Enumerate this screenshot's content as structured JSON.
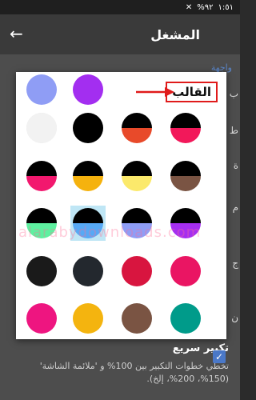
{
  "status_bar": {
    "time": "١:٥١",
    "battery": "%٩٢",
    "signal_off": "✕"
  },
  "app_bar": {
    "title": "المشغل",
    "back_icon": "arrow-left-icon"
  },
  "settings": {
    "section_label": "واجهة",
    "fragments": [
      "ب",
      "ط",
      "ة",
      "م",
      "ج",
      "ن"
    ]
  },
  "quick_zoom": {
    "title": "تكبير سريع",
    "description": "تخطي خطوات التكبير بين 100% و 'ملائمة الشاشة' (150%، 200%، إلخ).",
    "checked": true
  },
  "dialog": {
    "title": "القالب",
    "selected_index": 9,
    "themes": [
      {
        "top": "#f2f2f2",
        "bottom": "#f2f2f2"
      },
      {
        "top": "#000000",
        "bottom": "#000000"
      },
      {
        "top": "#000000",
        "bottom": "#e84a2a"
      },
      {
        "top": "#000000",
        "bottom": "#f2185a"
      },
      {
        "top": "#000000",
        "bottom": "#f2186e"
      },
      {
        "top": "#000000",
        "bottom": "#f5b20e"
      },
      {
        "top": "#000000",
        "bottom": "#fbe96b"
      },
      {
        "top": "#000000",
        "bottom": "#7a5443"
      },
      {
        "top": "#000000",
        "bottom": "#5ef0a0"
      },
      {
        "top": "#000000",
        "bottom": "#57a9f5"
      },
      {
        "top": "#000000",
        "bottom": "#8f9df5"
      },
      {
        "top": "#000000",
        "bottom": "#a62ef0"
      },
      {
        "top": "#1a1a1a",
        "bottom": "#1a1a1a"
      },
      {
        "top": "#23282e",
        "bottom": "#23282e"
      },
      {
        "top": "#d8153f",
        "bottom": "#d8153f"
      },
      {
        "top": "#ea1563",
        "bottom": "#ea1563"
      },
      {
        "top": "#ee1580",
        "bottom": "#ee1580"
      },
      {
        "top": "#f4b40f",
        "bottom": "#f4b40f"
      },
      {
        "top": "#7a5443",
        "bottom": "#7a5443"
      },
      {
        "top": "#009b8a",
        "bottom": "#009b8a"
      },
      {
        "top": "#8f9df5",
        "bottom": "#8f9df5"
      },
      {
        "top": "#a32ef0",
        "bottom": "#a32ef0"
      }
    ]
  },
  "watermark": "alarabydownloads.com",
  "colors": {
    "accent": "#4a78c8",
    "annotation_red": "#e01b1b",
    "selection": "#bfe6f5"
  }
}
